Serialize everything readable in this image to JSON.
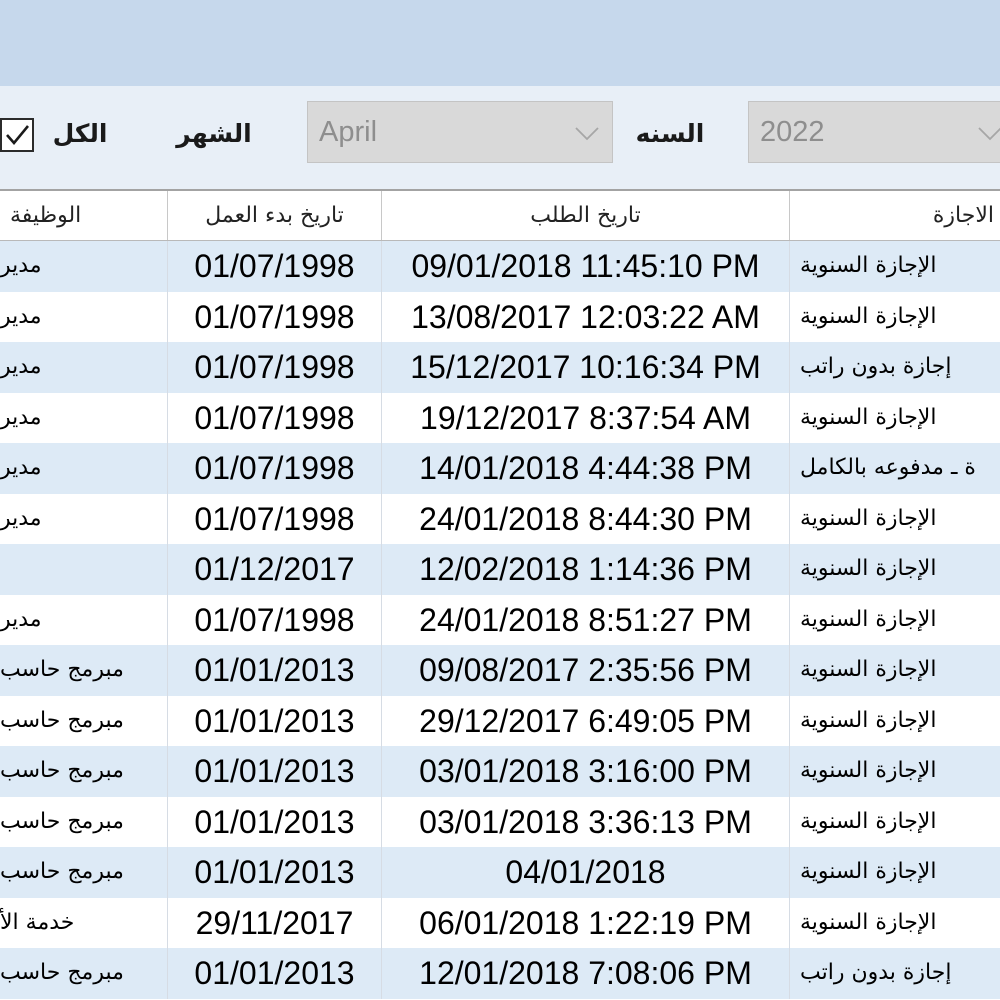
{
  "colors": {
    "header_band": "#C6D8EC",
    "filter_panel": "#E8EFF7",
    "alt_row": "#DDEAF6",
    "disabled_control": "#D9D9D9"
  },
  "filters": {
    "all": {
      "label": "الكل",
      "checked": true
    },
    "month": {
      "label": "الشهر",
      "value": "April",
      "enabled": false
    },
    "year": {
      "label": "السنه",
      "value": "2022",
      "enabled": false
    }
  },
  "grid": {
    "columns": {
      "job": "الوظيفة",
      "start_date": "تاريخ بدء العمل",
      "request_date": "تاريخ الطلب",
      "leave_type": "الاجازة"
    },
    "rows": [
      {
        "leave_type": "الإجازة السنوية",
        "request_date": "09/01/2018 11:45:10 PM",
        "start_date": "01/07/1998",
        "job": "مدير"
      },
      {
        "leave_type": "الإجازة السنوية",
        "request_date": "13/08/2017 12:03:22 AM",
        "start_date": "01/07/1998",
        "job": "مدير"
      },
      {
        "leave_type": "إجازة بدون راتب",
        "request_date": "15/12/2017 10:16:34 PM",
        "start_date": "01/07/1998",
        "job": "مدير"
      },
      {
        "leave_type": "الإجازة السنوية",
        "request_date": "19/12/2017 8:37:54 AM",
        "start_date": "01/07/1998",
        "job": "مدير"
      },
      {
        "leave_type": "ة ـ مدفوعه بالكامل",
        "request_date": "14/01/2018 4:44:38 PM",
        "start_date": "01/07/1998",
        "job": "مدير"
      },
      {
        "leave_type": "الإجازة السنوية",
        "request_date": "24/01/2018 8:44:30 PM",
        "start_date": "01/07/1998",
        "job": "مدير"
      },
      {
        "leave_type": "الإجازة السنوية",
        "request_date": "12/02/2018 1:14:36 PM",
        "start_date": "01/12/2017",
        "job": ""
      },
      {
        "leave_type": "الإجازة السنوية",
        "request_date": "24/01/2018 8:51:27 PM",
        "start_date": "01/07/1998",
        "job": "مدير"
      },
      {
        "leave_type": "الإجازة السنوية",
        "request_date": "09/08/2017 2:35:56 PM",
        "start_date": "01/01/2013",
        "job": "مبرمج حاسب"
      },
      {
        "leave_type": "الإجازة السنوية",
        "request_date": "29/12/2017 6:49:05 PM",
        "start_date": "01/01/2013",
        "job": "مبرمج حاسب"
      },
      {
        "leave_type": "الإجازة السنوية",
        "request_date": "03/01/2018 3:16:00 PM",
        "start_date": "01/01/2013",
        "job": "مبرمج حاسب"
      },
      {
        "leave_type": "الإجازة السنوية",
        "request_date": "03/01/2018 3:36:13 PM",
        "start_date": "01/01/2013",
        "job": "مبرمج حاسب"
      },
      {
        "leave_type": "الإجازة السنوية",
        "request_date": "04/01/2018",
        "start_date": "01/01/2013",
        "job": "مبرمج حاسب"
      },
      {
        "leave_type": "الإجازة السنوية",
        "request_date": "06/01/2018 1:22:19 PM",
        "start_date": "29/11/2017",
        "job": "خدمة الأ"
      },
      {
        "leave_type": "إجازة بدون راتب",
        "request_date": "12/01/2018 7:08:06 PM",
        "start_date": "01/01/2013",
        "job": "مبرمج حاسب"
      }
    ]
  }
}
